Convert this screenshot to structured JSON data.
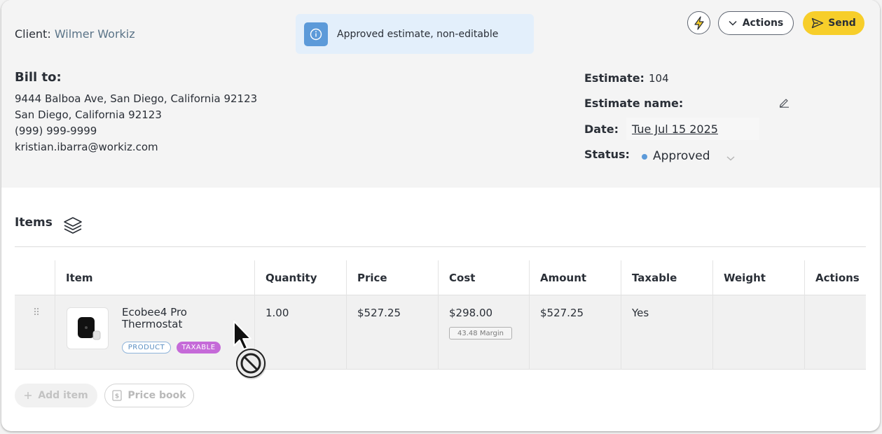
{
  "header": {
    "client_label": "Client:",
    "client_name": "Wilmer Workiz",
    "notice": "Approved estimate, non-editable",
    "actions_label": "Actions",
    "send_label": "Send"
  },
  "bill_to": {
    "title": "Bill to:",
    "address_line1": "9444 Balboa Ave, San Diego, California 92123",
    "address_line2": "San Diego, California 92123",
    "phone": "(999) 999-9999",
    "email": "kristian.ibarra@workiz.com"
  },
  "estimate": {
    "number_label": "Estimate:",
    "number": "104",
    "name_label": "Estimate name:",
    "date_label": "Date:",
    "date": "Tue Jul 15 2025",
    "status_label": "Status:",
    "status": "Approved"
  },
  "items": {
    "title": "Items",
    "columns": [
      "Item",
      "Quantity",
      "Price",
      "Cost",
      "Amount",
      "Taxable",
      "Weight",
      "Actions"
    ],
    "rows": [
      {
        "name": "Ecobee4 Pro Thermostat",
        "tags": [
          "PRODUCT",
          "TAXABLE"
        ],
        "quantity": "1.00",
        "price": "$527.25",
        "cost": "$298.00",
        "margin": "43.48 Margin",
        "amount": "$527.25",
        "taxable": "Yes",
        "weight": ""
      }
    ],
    "add_item_label": "Add item",
    "price_book_label": "Price book"
  },
  "colors": {
    "accent_yellow": "#f7ce2a",
    "info_blue": "#5c9ad9",
    "taxable_tag": "#c56ad8"
  }
}
